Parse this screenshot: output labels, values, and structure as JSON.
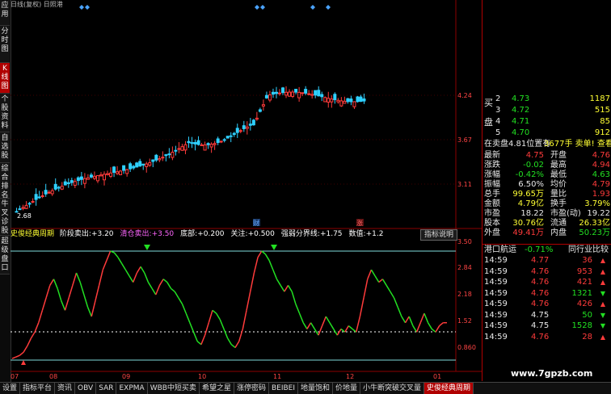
{
  "left_tabs": [
    {
      "label": "应用",
      "active": false
    },
    {
      "label": "分时图",
      "active": false
    },
    {
      "label": "K线图",
      "active": true
    },
    {
      "label": "个股资料",
      "active": false
    },
    {
      "label": "自选股",
      "active": false
    },
    {
      "label": "综合排名",
      "active": false
    },
    {
      "label": "牛叉诊股",
      "active": false
    },
    {
      "label": "超级盘口",
      "active": false
    }
  ],
  "chart": {
    "header_text": "日线(复权)  日照港",
    "price_ticks": [
      "4.24",
      "3.67",
      "3.11"
    ],
    "low_label": "2.68",
    "markers": [
      "财",
      "涨"
    ],
    "date_ticks": [
      "07",
      "08",
      "09",
      "10",
      "11",
      "12",
      "01"
    ]
  },
  "indicator": {
    "name": "史俊经典周期",
    "items": [
      {
        "label": "阶段卖出:",
        "value": "+3.20",
        "color": "#ffffff"
      },
      {
        "label": "清仓卖出:",
        "value": "+3.50",
        "color": "#ff66ff"
      },
      {
        "label": "底部:",
        "value": "+0.200",
        "color": "#ffffff"
      },
      {
        "label": "关注:",
        "value": "+0.500",
        "color": "#ffffff"
      },
      {
        "label": "强弱分界线:",
        "value": "+1.75",
        "color": "#ffffff"
      },
      {
        "label": "数值:",
        "value": "+1.2",
        "color": "#ffffff"
      }
    ],
    "explain_button": "指标说明",
    "ticks": [
      "3.50",
      "2.84",
      "2.18",
      "1.52",
      "0.860"
    ],
    "series": [
      0.05,
      0.1,
      0.15,
      0.25,
      0.45,
      0.7,
      0.9,
      1.2,
      1.6,
      2.0,
      2.4,
      2.6,
      2.3,
      1.9,
      1.6,
      2.0,
      2.4,
      2.8,
      2.5,
      2.1,
      1.7,
      1.4,
      1.9,
      2.4,
      2.9,
      3.2,
      3.5,
      3.45,
      3.3,
      3.1,
      2.9,
      2.7,
      2.5,
      2.8,
      3.0,
      2.8,
      2.5,
      2.3,
      2.1,
      2.4,
      2.6,
      2.5,
      2.3,
      2.2,
      2.0,
      1.8,
      1.5,
      1.2,
      0.9,
      0.6,
      0.5,
      0.8,
      1.2,
      1.6,
      1.5,
      1.3,
      1.0,
      0.7,
      0.5,
      0.4,
      0.6,
      1.0,
      1.6,
      2.2,
      2.8,
      3.3,
      3.5,
      3.4,
      3.2,
      2.9,
      2.6,
      2.4,
      2.2,
      2.4,
      2.2,
      1.8,
      1.5,
      1.2,
      1.0,
      1.2,
      1.0,
      0.8,
      1.1,
      1.4,
      1.2,
      1.0,
      0.8,
      1.0,
      0.9,
      1.1,
      1.0,
      0.9,
      1.4,
      2.0,
      2.6,
      2.9,
      2.7,
      2.5,
      2.6,
      2.4,
      2.2,
      2.0,
      1.7,
      1.4,
      1.2,
      1.4,
      1.1,
      0.9,
      1.2,
      1.5,
      1.2,
      1.0,
      0.9,
      1.1,
      1.2,
      1.2
    ],
    "strong_weak_line": 1.75
  },
  "quote": {
    "buy_label": "买盘",
    "buy_rows": [
      {
        "level": "2",
        "price": "4.73",
        "vol": "1187"
      },
      {
        "level": "3",
        "price": "4.72",
        "vol": "515"
      },
      {
        "level": "4",
        "price": "4.71",
        "vol": "85"
      },
      {
        "level": "5",
        "price": "4.70",
        "vol": "912"
      }
    ],
    "summary_left": "在卖盘4.81位置有",
    "summary_right": "3677手  卖单! 查看详细",
    "stats": [
      {
        "l1": "最新",
        "v1": "4.75",
        "c1": "#ff3b3b",
        "l2": "开盘",
        "v2": "4.76",
        "c2": "#ff3b3b"
      },
      {
        "l1": "涨跌",
        "v1": "-0.02",
        "c1": "#22e022",
        "l2": "最高",
        "v2": "4.94",
        "c2": "#ff3b3b"
      },
      {
        "l1": "涨幅",
        "v1": "-0.42%",
        "c1": "#22e022",
        "l2": "最低",
        "v2": "4.63",
        "c2": "#22e022"
      },
      {
        "l1": "振幅",
        "v1": "6.50%",
        "c1": "#e8e8e8",
        "l2": "均价",
        "v2": "4.79",
        "c2": "#ff3b3b"
      },
      {
        "l1": "总手",
        "v1": "99.65万",
        "c1": "#ffff33",
        "l2": "量比",
        "v2": "1.93",
        "c2": "#ff3b3b"
      },
      {
        "l1": "金额",
        "v1": "4.79亿",
        "c1": "#ffff33",
        "l2": "换手",
        "v2": "3.79%",
        "c2": "#ffff33"
      },
      {
        "l1": "市盈",
        "v1": "18.22",
        "c1": "#e8e8e8",
        "l2": "市盈(动)",
        "v2": "19.22",
        "c2": "#e8e8e8"
      },
      {
        "l1": "股本",
        "v1": "30.76亿",
        "c1": "#ffff33",
        "l2": "流通",
        "v2": "26.33亿",
        "c2": "#ffff33"
      },
      {
        "l1": "外盘",
        "v1": "49.41万",
        "c1": "#ff3b3b",
        "l2": "内盘",
        "v2": "50.23万",
        "c2": "#22e022"
      }
    ],
    "sector": {
      "name": "港口航运",
      "change": "-0.71%",
      "compare": "同行业比较"
    },
    "ticks": [
      {
        "time": "14:59",
        "price": "4.77",
        "pc": "#ff3b3b",
        "vol": "36",
        "vc": "#ff3b3b",
        "dir": "up"
      },
      {
        "time": "14:59",
        "price": "4.76",
        "pc": "#ff3b3b",
        "vol": "953",
        "vc": "#ff3b3b",
        "dir": "up"
      },
      {
        "time": "14:59",
        "price": "4.76",
        "pc": "#ff3b3b",
        "vol": "421",
        "vc": "#ff3b3b",
        "dir": "up"
      },
      {
        "time": "14:59",
        "price": "4.76",
        "pc": "#ff3b3b",
        "vol": "1321",
        "vc": "#22e022",
        "dir": "down"
      },
      {
        "time": "14:59",
        "price": "4.76",
        "pc": "#ff3b3b",
        "vol": "426",
        "vc": "#ff3b3b",
        "dir": "up"
      },
      {
        "time": "14:59",
        "price": "4.75",
        "pc": "#e8e8e8",
        "vol": "50",
        "vc": "#22e022",
        "dir": "down"
      },
      {
        "time": "14:59",
        "price": "4.75",
        "pc": "#e8e8e8",
        "vol": "1528",
        "vc": "#22e022",
        "dir": "down"
      },
      {
        "time": "14:59",
        "price": "4.76",
        "pc": "#ff3b3b",
        "vol": "28",
        "vc": "#ff3b3b",
        "dir": "up"
      }
    ]
  },
  "bottom_tabs": [
    {
      "label": "设置",
      "active": false
    },
    {
      "label": "指标平台",
      "active": false
    },
    {
      "label": "资讯",
      "active": false
    },
    {
      "label": "OBV",
      "active": false
    },
    {
      "label": "SAR",
      "active": false
    },
    {
      "label": "EXPMA",
      "active": false
    },
    {
      "label": "WBB中短买卖",
      "active": false
    },
    {
      "label": "希望之星",
      "active": false
    },
    {
      "label": "涨停密码",
      "active": false
    },
    {
      "label": "BEIBEI",
      "active": false
    },
    {
      "label": "地量饱和",
      "active": false
    },
    {
      "label": "价地量",
      "active": false
    },
    {
      "label": "小牛断突破交叉量",
      "active": false
    },
    {
      "label": "史俊经典周期",
      "active": true
    }
  ],
  "watermark": "www.7gpzb.com",
  "colors": {
    "up": "#ff3b3b",
    "down": "#22e022",
    "accent": "#b00000",
    "line_cyan": "#7fdcdc"
  }
}
